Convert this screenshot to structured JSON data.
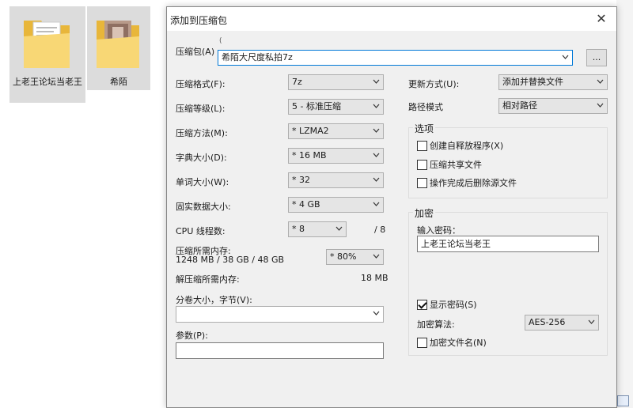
{
  "desktop": {
    "files": [
      {
        "label": "上老王论坛当老王"
      },
      {
        "label": "希陌"
      }
    ]
  },
  "dialog": {
    "title": "添加到压缩包",
    "close_glyph": "✕",
    "archive": {
      "label": "压缩包(A)",
      "path_hint": "(",
      "name": "希陌大尺度私拍7z",
      "browse_label": "..."
    },
    "left": {
      "format": {
        "label": "压缩格式(F):",
        "value": "7z"
      },
      "level": {
        "label": "压缩等级(L):",
        "value": "5 - 标准压缩"
      },
      "method": {
        "label": "压缩方法(M):",
        "value": "* LZMA2"
      },
      "dict": {
        "label": "字典大小(D):",
        "value": "* 16 MB"
      },
      "word": {
        "label": "单词大小(W):",
        "value": "* 32"
      },
      "solid": {
        "label": "固实数据大小:",
        "value": "* 4 GB"
      },
      "cpu": {
        "label": "CPU 线程数:",
        "value": "* 8",
        "max": "/ 8"
      },
      "memory": {
        "label": "压缩所需内存:",
        "detail": "1248 MB / 38 GB / 48 GB",
        "value": "* 80%"
      },
      "decomp": {
        "label": "解压缩所需内存:",
        "value": "18 MB"
      },
      "volume": {
        "label": "分卷大小，字节(V):",
        "value": ""
      },
      "params": {
        "label": "参数(P):",
        "value": ""
      }
    },
    "right": {
      "update": {
        "label": "更新方式(U):",
        "value": "添加并替换文件"
      },
      "path_mode": {
        "label": "路径模式",
        "value": "相对路径"
      },
      "options": {
        "title": "选项",
        "items": [
          {
            "label": "创建自释放程序(X)",
            "checked": false
          },
          {
            "label": "压缩共享文件",
            "checked": false
          },
          {
            "label": "操作完成后删除源文件",
            "checked": false
          }
        ]
      },
      "encryption": {
        "title": "加密",
        "password_label": "输入密码：",
        "password_value": "上老王论坛当老王",
        "show_password": {
          "label": "显示密码(S)",
          "checked": true
        },
        "method_label": "加密算法:",
        "method_value": "AES-256",
        "encrypt_names": {
          "label": "加密文件名(N)",
          "checked": false
        }
      }
    }
  },
  "colors": {
    "dialog_bg": "#f0f0f0",
    "accent": "#0078d7",
    "folder": "#f8d775"
  }
}
